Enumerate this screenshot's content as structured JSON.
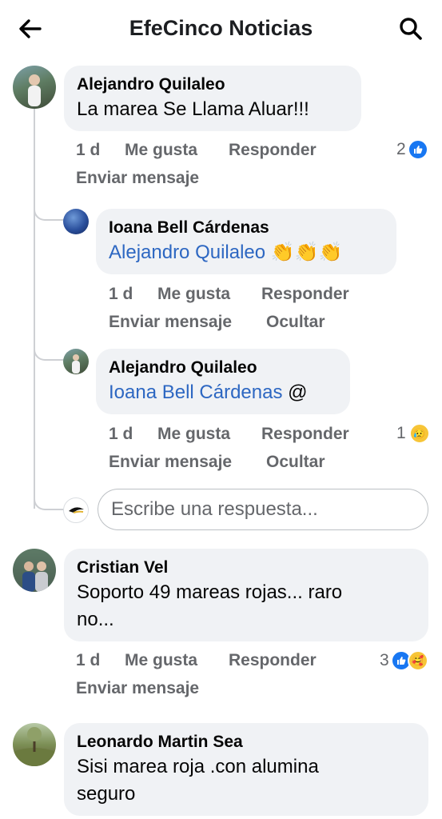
{
  "header": {
    "title": "EfeCinco Noticias",
    "back_icon": "arrow-left-icon",
    "search_icon": "search-icon"
  },
  "comments": [
    {
      "author": "Alejandro Quilaleo",
      "text": "La marea Se Llama Aluar!!!",
      "time": "1 d",
      "like": "Me gusta",
      "reply": "Responder",
      "message": "Enviar mensaje",
      "reaction_count": "2",
      "replies": [
        {
          "author": "Ioana Bell Cárdenas",
          "mention": "Alejandro Quilaleo",
          "suffix": "👏👏👏",
          "time": "1 d",
          "like": "Me gusta",
          "reply": "Responder",
          "message": "Enviar mensaje",
          "hide": "Ocultar"
        },
        {
          "author": "Alejandro Quilaleo",
          "mention": "Ioana Bell Cárdenas",
          "suffix": "@",
          "time": "1 d",
          "like": "Me gusta",
          "reply": "Responder",
          "message": "Enviar mensaje",
          "hide": "Ocultar",
          "reaction_count": "1",
          "reaction_emoji": "😥"
        }
      ],
      "reply_placeholder": "Escribe una respuesta..."
    },
    {
      "author": "Cristian Vel",
      "text_line1": "Soporto 49 mareas rojas... raro",
      "text_line2": "no...",
      "time": "1 d",
      "like": "Me gusta",
      "reply": "Responder",
      "message": "Enviar mensaje",
      "reaction_count": "3",
      "reaction_emoji": "🥰"
    },
    {
      "author": "Leonardo Martin Sea",
      "text_line1": "Sisi marea roja .con alumina",
      "text_line2": "seguro"
    }
  ],
  "colors": {
    "accent": "#1877f2",
    "mention": "#2d67c2",
    "bubble": "#f0f2f5",
    "meta": "#65676b"
  }
}
